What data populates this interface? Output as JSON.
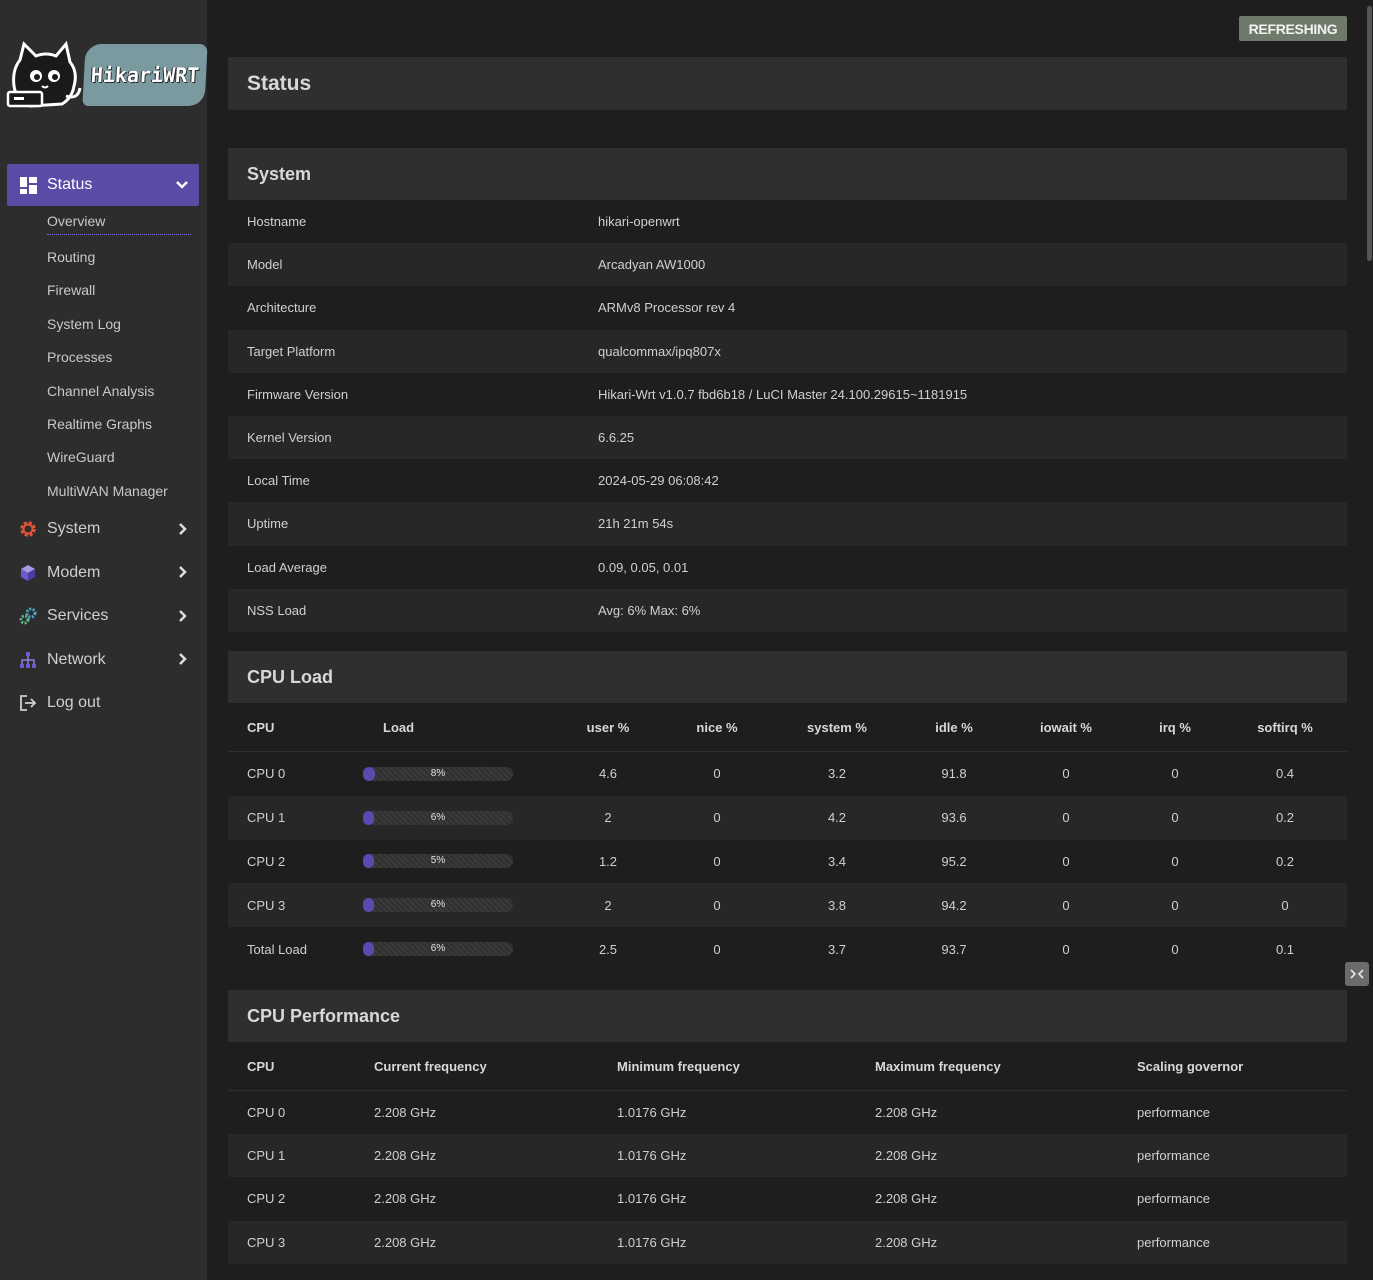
{
  "brand": {
    "logo_text": "HikariWRT"
  },
  "refresh_label": "REFRESHING",
  "page_title": "Status",
  "nav": {
    "status": {
      "label": "Status"
    },
    "status_sub": [
      "Overview",
      "Routing",
      "Firewall",
      "System Log",
      "Processes",
      "Channel Analysis",
      "Realtime Graphs",
      "WireGuard",
      "MultiWAN Manager"
    ],
    "system": {
      "label": "System"
    },
    "modem": {
      "label": "Modem"
    },
    "services": {
      "label": "Services"
    },
    "network": {
      "label": "Network"
    },
    "logout": {
      "label": "Log out"
    }
  },
  "colors": {
    "accent": "#5b4ba6",
    "sidebar": "#2d2d2d",
    "background": "#1e1e1e"
  },
  "system": {
    "title": "System",
    "rows": [
      {
        "k": "Hostname",
        "v": "hikari-openwrt"
      },
      {
        "k": "Model",
        "v": "Arcadyan AW1000"
      },
      {
        "k": "Architecture",
        "v": "ARMv8 Processor rev 4"
      },
      {
        "k": "Target Platform",
        "v": "qualcommax/ipq807x"
      },
      {
        "k": "Firmware Version",
        "v": "Hikari-Wrt v1.0.7 fbd6b18 / LuCI Master 24.100.29615~1181915"
      },
      {
        "k": "Kernel Version",
        "v": "6.6.25"
      },
      {
        "k": "Local Time",
        "v": "2024-05-29 06:08:42"
      },
      {
        "k": "Uptime",
        "v": "21h 21m 54s"
      },
      {
        "k": "Load Average",
        "v": "0.09, 0.05, 0.01"
      },
      {
        "k": "NSS Load",
        "v": "Avg: 6% Max: 6%"
      }
    ]
  },
  "cpu_load": {
    "title": "CPU Load",
    "headers": [
      "CPU",
      "Load",
      "user %",
      "nice %",
      "system %",
      "idle %",
      "iowait %",
      "irq %",
      "softirq %"
    ],
    "rows": [
      {
        "cpu": "CPU 0",
        "load": "8%",
        "load_value": 8,
        "user": "4.6",
        "nice": "0",
        "system": "3.2",
        "idle": "91.8",
        "iowait": "0",
        "irq": "0",
        "softirq": "0.4"
      },
      {
        "cpu": "CPU 1",
        "load": "6%",
        "load_value": 6,
        "user": "2",
        "nice": "0",
        "system": "4.2",
        "idle": "93.6",
        "iowait": "0",
        "irq": "0",
        "softirq": "0.2"
      },
      {
        "cpu": "CPU 2",
        "load": "5%",
        "load_value": 5,
        "user": "1.2",
        "nice": "0",
        "system": "3.4",
        "idle": "95.2",
        "iowait": "0",
        "irq": "0",
        "softirq": "0.2"
      },
      {
        "cpu": "CPU 3",
        "load": "6%",
        "load_value": 6,
        "user": "2",
        "nice": "0",
        "system": "3.8",
        "idle": "94.2",
        "iowait": "0",
        "irq": "0",
        "softirq": "0"
      },
      {
        "cpu": "Total Load",
        "load": "6%",
        "load_value": 6,
        "user": "2.5",
        "nice": "0",
        "system": "3.7",
        "idle": "93.7",
        "iowait": "0",
        "irq": "0",
        "softirq": "0.1"
      }
    ]
  },
  "cpu_perf": {
    "title": "CPU Performance",
    "headers": [
      "CPU",
      "Current frequency",
      "Minimum frequency",
      "Maximum frequency",
      "Scaling governor"
    ],
    "rows": [
      {
        "cpu": "CPU 0",
        "cur": "2.208 GHz",
        "min": "1.0176 GHz",
        "max": "2.208 GHz",
        "gov": "performance"
      },
      {
        "cpu": "CPU 1",
        "cur": "2.208 GHz",
        "min": "1.0176 GHz",
        "max": "2.208 GHz",
        "gov": "performance"
      },
      {
        "cpu": "CPU 2",
        "cur": "2.208 GHz",
        "min": "1.0176 GHz",
        "max": "2.208 GHz",
        "gov": "performance"
      },
      {
        "cpu": "CPU 3",
        "cur": "2.208 GHz",
        "min": "1.0176 GHz",
        "max": "2.208 GHz",
        "gov": "performance"
      }
    ]
  }
}
